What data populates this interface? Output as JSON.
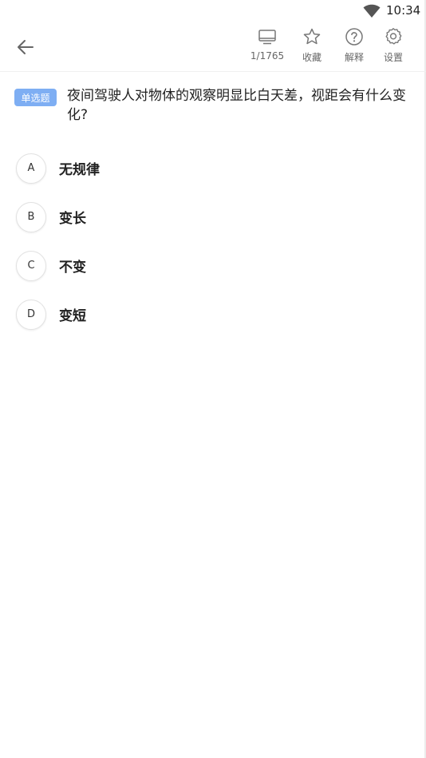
{
  "status_bar": {
    "time": "10:34",
    "wifi_icon": "wifi-icon"
  },
  "toolbar": {
    "back_icon": "arrow-left-icon",
    "items": [
      {
        "icon": "screen-icon",
        "label": "1/1765"
      },
      {
        "icon": "star-icon",
        "label": "收藏"
      },
      {
        "icon": "question-circle-icon",
        "label": "解释"
      },
      {
        "icon": "gear-icon",
        "label": "设置"
      }
    ]
  },
  "question": {
    "type_badge": "单选题",
    "text": "夜间驾驶人对物体的观察明显比白天差，视距会有什么变化?"
  },
  "options": [
    {
      "letter": "A",
      "text": "无规律"
    },
    {
      "letter": "B",
      "text": "变长"
    },
    {
      "letter": "C",
      "text": "不变"
    },
    {
      "letter": "D",
      "text": "变短"
    }
  ],
  "colors": {
    "badge": "#7eaef3",
    "icon_gray": "#777777"
  }
}
